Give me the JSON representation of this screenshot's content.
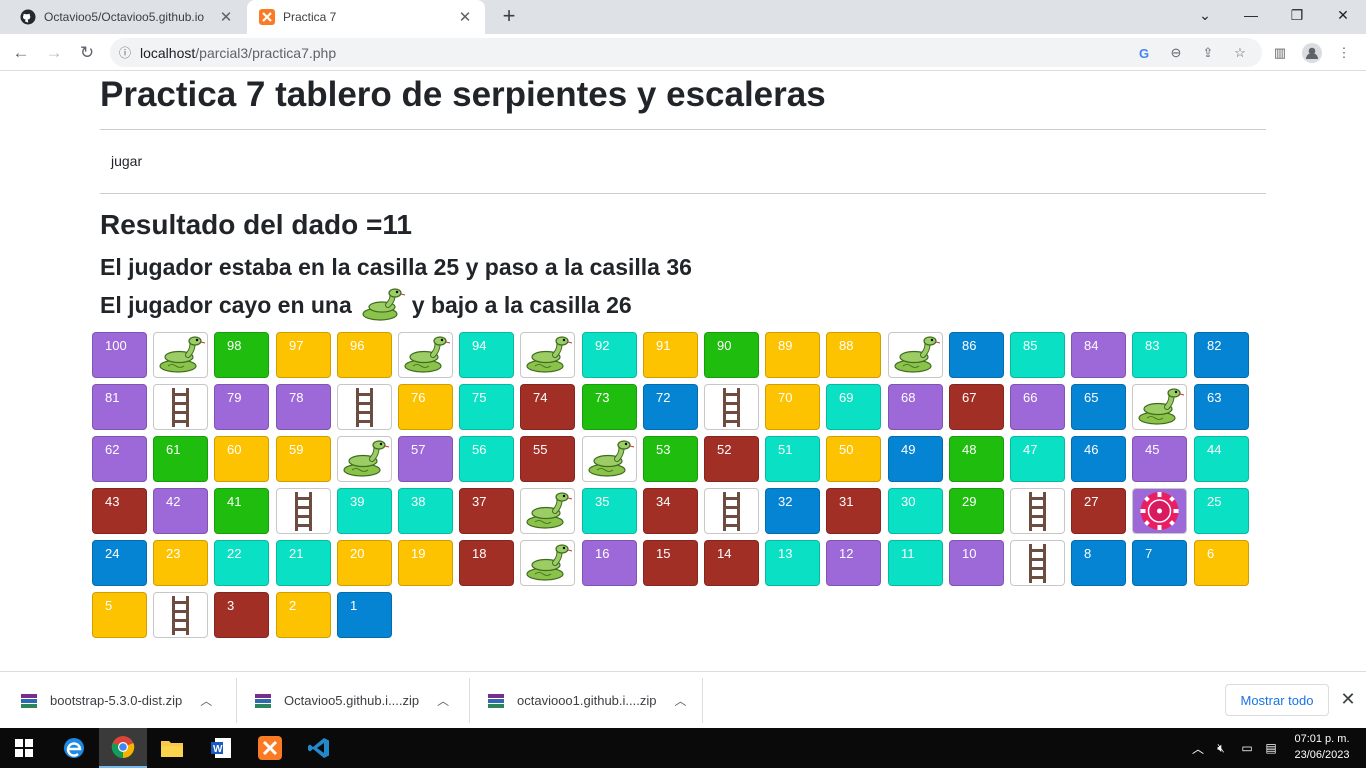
{
  "browser": {
    "tabs": [
      {
        "title": "Octavioo5/Octavioo5.github.io",
        "icon": "github-icon",
        "active": false
      },
      {
        "title": "Practica 7",
        "icon": "xampp-icon",
        "active": true
      }
    ],
    "new_tab": "+",
    "url_host": "localhost",
    "url_path": "/parcial3/practica7.php"
  },
  "page": {
    "title": "Practica 7 tablero de serpientes y escaleras",
    "play_link": "jugar",
    "dice_result": "Resultado del dado =11",
    "move_text": "El jugador estaba en la casilla 25 y paso a la casilla 36",
    "event_prefix": "El jugador cayo en una",
    "event_suffix": "y bajo a la casilla 26"
  },
  "colors": {
    "purple": "#9d68d8",
    "green": "#1fbe0e",
    "yellow": "#fdc300",
    "teal": "#0ae1c4",
    "blue": "#0584d3",
    "red": "#a22f26"
  },
  "board": {
    "rows": [
      [
        {
          "n": "100",
          "c": "purple"
        },
        {
          "t": "snake"
        },
        {
          "n": "98",
          "c": "green"
        },
        {
          "n": "97",
          "c": "yellow"
        },
        {
          "n": "96",
          "c": "yellow"
        },
        {
          "t": "snake"
        },
        {
          "n": "94",
          "c": "teal"
        },
        {
          "t": "snake"
        },
        {
          "n": "92",
          "c": "teal"
        },
        {
          "n": "91",
          "c": "yellow"
        },
        {
          "n": "90",
          "c": "green"
        },
        {
          "n": "89",
          "c": "yellow"
        },
        {
          "n": "88",
          "c": "yellow"
        },
        {
          "t": "snake"
        },
        {
          "n": "86",
          "c": "blue"
        },
        {
          "n": "85",
          "c": "teal"
        },
        {
          "n": "84",
          "c": "purple"
        },
        {
          "n": "83",
          "c": "teal"
        },
        {
          "n": "82",
          "c": "blue"
        }
      ],
      [
        {
          "n": "81",
          "c": "purple"
        },
        {
          "t": "ladder"
        },
        {
          "n": "79",
          "c": "purple"
        },
        {
          "n": "78",
          "c": "purple"
        },
        {
          "t": "ladder"
        },
        {
          "n": "76",
          "c": "yellow"
        },
        {
          "n": "75",
          "c": "teal"
        },
        {
          "n": "74",
          "c": "red"
        },
        {
          "n": "73",
          "c": "green"
        },
        {
          "n": "72",
          "c": "blue"
        },
        {
          "t": "ladder"
        },
        {
          "n": "70",
          "c": "yellow"
        },
        {
          "n": "69",
          "c": "teal"
        },
        {
          "n": "68",
          "c": "purple"
        },
        {
          "n": "67",
          "c": "red"
        },
        {
          "n": "66",
          "c": "purple"
        },
        {
          "n": "65",
          "c": "blue"
        },
        {
          "t": "snake"
        },
        {
          "n": "63",
          "c": "blue"
        }
      ],
      [
        {
          "n": "62",
          "c": "purple"
        },
        {
          "n": "61",
          "c": "green"
        },
        {
          "n": "60",
          "c": "yellow"
        },
        {
          "n": "59",
          "c": "yellow"
        },
        {
          "t": "snake"
        },
        {
          "n": "57",
          "c": "purple"
        },
        {
          "n": "56",
          "c": "teal"
        },
        {
          "n": "55",
          "c": "red"
        },
        {
          "t": "snake"
        },
        {
          "n": "53",
          "c": "green"
        },
        {
          "n": "52",
          "c": "red"
        },
        {
          "n": "51",
          "c": "teal"
        },
        {
          "n": "50",
          "c": "yellow"
        },
        {
          "n": "49",
          "c": "blue"
        },
        {
          "n": "48",
          "c": "green"
        },
        {
          "n": "47",
          "c": "teal"
        },
        {
          "n": "46",
          "c": "blue"
        },
        {
          "n": "45",
          "c": "purple"
        },
        {
          "n": "44",
          "c": "teal"
        }
      ],
      [
        {
          "n": "43",
          "c": "red"
        },
        {
          "n": "42",
          "c": "purple"
        },
        {
          "n": "41",
          "c": "green"
        },
        {
          "t": "ladder"
        },
        {
          "n": "39",
          "c": "teal"
        },
        {
          "n": "38",
          "c": "teal"
        },
        {
          "n": "37",
          "c": "red"
        },
        {
          "t": "snake"
        },
        {
          "n": "35",
          "c": "teal"
        },
        {
          "n": "34",
          "c": "red"
        },
        {
          "t": "ladder"
        },
        {
          "n": "32",
          "c": "blue"
        },
        {
          "n": "31",
          "c": "red"
        },
        {
          "n": "30",
          "c": "teal"
        },
        {
          "n": "29",
          "c": "green"
        },
        {
          "t": "ladder"
        },
        {
          "n": "27",
          "c": "red"
        },
        {
          "t": "token"
        },
        {
          "n": "25",
          "c": "teal"
        }
      ],
      [
        {
          "n": "24",
          "c": "blue"
        },
        {
          "n": "23",
          "c": "yellow"
        },
        {
          "n": "22",
          "c": "teal"
        },
        {
          "n": "21",
          "c": "teal"
        },
        {
          "n": "20",
          "c": "yellow"
        },
        {
          "n": "19",
          "c": "yellow"
        },
        {
          "n": "18",
          "c": "red"
        },
        {
          "t": "snake"
        },
        {
          "n": "16",
          "c": "purple"
        },
        {
          "n": "15",
          "c": "red"
        },
        {
          "n": "14",
          "c": "red"
        },
        {
          "n": "13",
          "c": "teal"
        },
        {
          "n": "12",
          "c": "purple"
        },
        {
          "n": "11",
          "c": "teal"
        },
        {
          "n": "10",
          "c": "purple"
        },
        {
          "t": "ladder"
        },
        {
          "n": "8",
          "c": "blue"
        },
        {
          "n": "7",
          "c": "blue"
        },
        {
          "n": "6",
          "c": "yellow"
        }
      ],
      [
        {
          "n": "5",
          "c": "yellow"
        },
        {
          "t": "ladder"
        },
        {
          "n": "3",
          "c": "red"
        },
        {
          "n": "2",
          "c": "yellow"
        },
        {
          "n": "1",
          "c": "blue"
        }
      ]
    ]
  },
  "downloads": {
    "items": [
      {
        "name": "bootstrap-5.3.0-dist.zip"
      },
      {
        "name": "Octavioo5.github.i....zip"
      },
      {
        "name": "octaviooo1.github.i....zip"
      }
    ],
    "show_all": "Mostrar todo"
  },
  "taskbar": {
    "time": "07:01 p. m.",
    "date": "23/06/2023"
  }
}
